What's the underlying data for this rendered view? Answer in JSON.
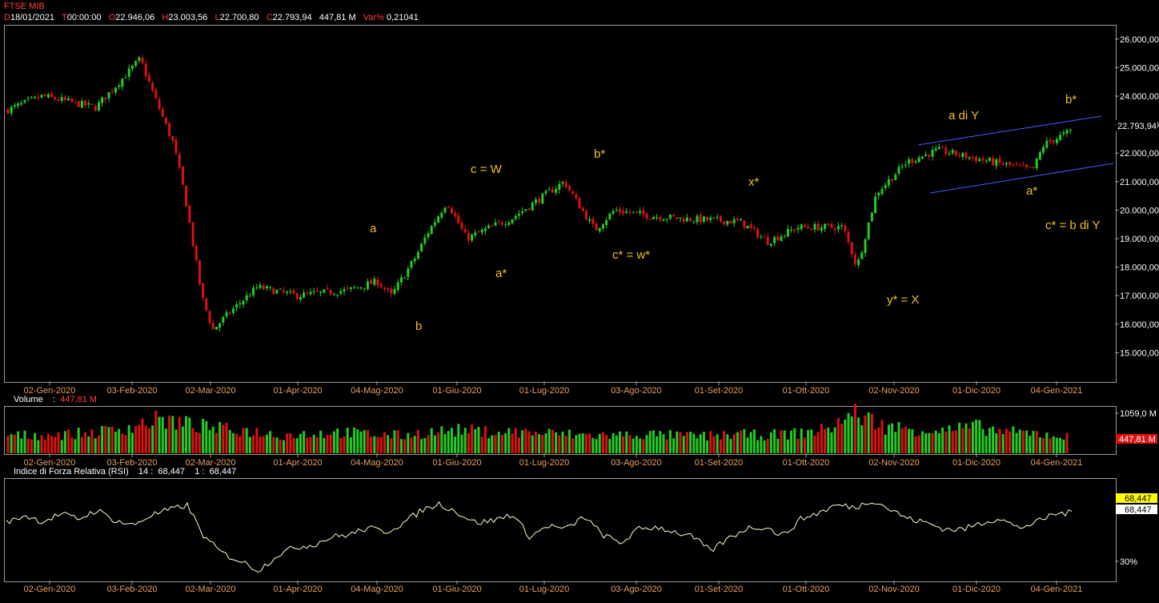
{
  "header": {
    "symbol": "FTSE MIB",
    "date_label": "D",
    "date": "18/01/2021",
    "time_label": "T",
    "time": "00:00:00",
    "open_label": "O",
    "open": "22.946,06",
    "high_label": "H",
    "high": "23.003,56",
    "low_label": "L",
    "low": "22.700,80",
    "close_label": "C",
    "close": "22.793,94",
    "volume": "447,81 M",
    "var_label": "Var%",
    "var": "0,21041"
  },
  "colors": {
    "up": "#22cc22",
    "down": "#dd1111",
    "accent_label": "#ff4040",
    "annotation": "#f0c020",
    "channel": "#4060ff",
    "rsi_line": "#ffffcc"
  },
  "x_ticks": [
    "02-Gen-2020",
    "03-Feb-2020",
    "02-Mar-2020",
    "01-Apr-2020",
    "04-Mag-2020",
    "01-Giu-2020",
    "01-Lug-2020",
    "03-Ago-2020",
    "01-Set-2020",
    "01-Ott-2020",
    "02-Nov-2020",
    "01-Dic-2020",
    "04-Gen-2021"
  ],
  "chart_data": [
    {
      "type": "candlestick",
      "name": "FTSE MIB",
      "y_ticks": [
        "26.000,00",
        "25.000,00",
        "24.000,00",
        "23.000,00",
        "22.000,00",
        "21.000,00",
        "20.000,00",
        "19.000,00",
        "18.000,00",
        "17.000,00",
        "16.000,00",
        "15.000,00"
      ],
      "ylim": [
        14000,
        26500
      ],
      "last_price_label": "22.793,94",
      "x": [
        "2020-01-02",
        "2020-01-15",
        "2020-02-03",
        "2020-02-19",
        "2020-02-24",
        "2020-03-02",
        "2020-03-06",
        "2020-03-12",
        "2020-03-16",
        "2020-03-23",
        "2020-04-01",
        "2020-04-15",
        "2020-05-04",
        "2020-05-14",
        "2020-05-19",
        "2020-05-28",
        "2020-06-01",
        "2020-06-08",
        "2020-06-15",
        "2020-06-26",
        "2020-07-01",
        "2020-07-20",
        "2020-07-31",
        "2020-08-07",
        "2020-08-20",
        "2020-09-01",
        "2020-09-21",
        "2020-10-01",
        "2020-10-12",
        "2020-10-28",
        "2020-11-02",
        "2020-11-09",
        "2020-11-20",
        "2020-12-01",
        "2020-12-15",
        "2021-01-04",
        "2021-01-08",
        "2021-01-18"
      ],
      "close": [
        23500,
        24000,
        23600,
        25300,
        24000,
        22300,
        20500,
        17000,
        15800,
        16500,
        17300,
        17000,
        17200,
        17500,
        17000,
        18400,
        19200,
        20300,
        19000,
        19500,
        19700,
        21000,
        19300,
        20000,
        19800,
        19700,
        19600,
        18900,
        19400,
        19400,
        18000,
        20600,
        21700,
        22100,
        21800,
        21400,
        22300,
        22790
      ],
      "annotations": [
        "a",
        "b",
        "c = W",
        "a*",
        "b*",
        "c* = w*",
        "x*",
        "y* = X",
        "a di Y",
        "a*",
        "b*",
        "c* = b di Y"
      ]
    },
    {
      "type": "bar",
      "name": "Volume",
      "label": "Volume",
      "last_value": "447,81 M",
      "y_ticks": [
        "1059,0 M"
      ],
      "values": [
        460,
        480,
        500,
        560,
        690,
        900,
        760,
        640,
        590,
        480,
        520,
        560,
        500,
        470,
        560,
        610,
        560,
        560,
        520,
        480,
        470,
        500,
        470,
        450,
        500,
        480,
        520,
        620,
        1059,
        700,
        640,
        600,
        700,
        560,
        520,
        447.81
      ]
    },
    {
      "type": "line",
      "name": "Indice di Forza Relativa (RSI)",
      "label": "Indice di Forza Relativa (RSI)",
      "period_a": "14",
      "period_b": "1",
      "value_text": "68,447",
      "marker_yellow": "68,447",
      "marker_white": "68,447",
      "y_ticks": [
        "30%"
      ],
      "ylim": [
        15,
        95
      ],
      "values": [
        60,
        66,
        61,
        67,
        63,
        70,
        62,
        58,
        66,
        70,
        74,
        48,
        36,
        30,
        23,
        35,
        41,
        43,
        49,
        51,
        56,
        53,
        60,
        70,
        75,
        68,
        60,
        62,
        67,
        49,
        58,
        55,
        65,
        51,
        44,
        55,
        57,
        53,
        49,
        38,
        48,
        56,
        57,
        50,
        63,
        68,
        74,
        72,
        78,
        70,
        63,
        60,
        55,
        55,
        60,
        64,
        56,
        60,
        67,
        68
      ]
    }
  ]
}
